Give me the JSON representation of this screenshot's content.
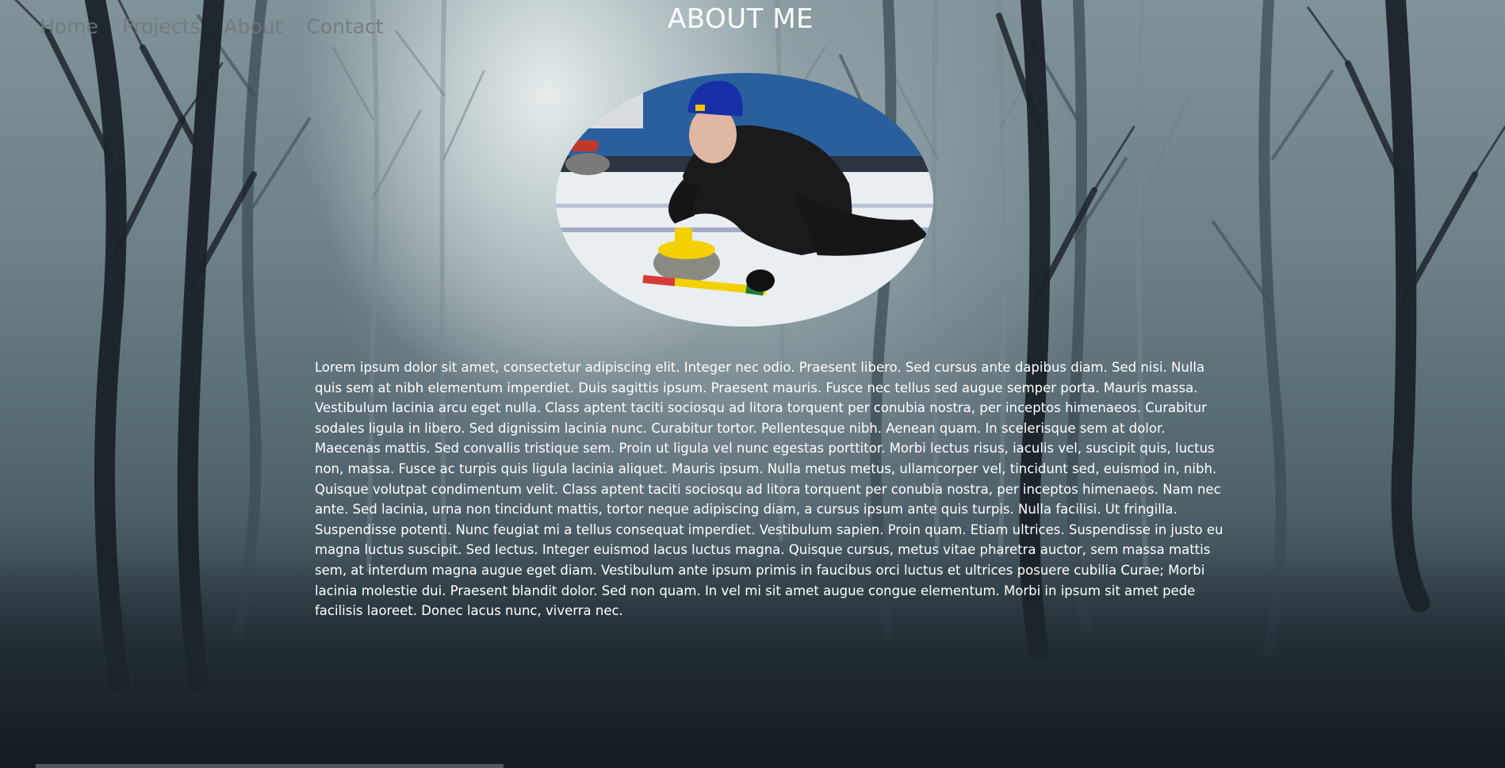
{
  "nav": {
    "items": [
      {
        "label": "Home"
      },
      {
        "label": "Projects"
      },
      {
        "label": "About"
      },
      {
        "label": "Contact"
      }
    ]
  },
  "page": {
    "title": "ABOUT ME"
  },
  "profile_photo": {
    "icon": "curling-player-photo"
  },
  "bio": {
    "text": "Lorem ipsum dolor sit amet, consectetur adipiscing elit. Integer nec odio. Praesent libero. Sed cursus ante dapibus diam. Sed nisi. Nulla quis sem at nibh elementum imperdiet. Duis sagittis ipsum. Praesent mauris. Fusce nec tellus sed augue semper porta. Mauris massa. Vestibulum lacinia arcu eget nulla. Class aptent taciti sociosqu ad litora torquent per conubia nostra, per inceptos himenaeos. Curabitur sodales ligula in libero. Sed dignissim lacinia nunc. Curabitur tortor. Pellentesque nibh. Aenean quam. In scelerisque sem at dolor. Maecenas mattis. Sed convallis tristique sem. Proin ut ligula vel nunc egestas porttitor. Morbi lectus risus, iaculis vel, suscipit quis, luctus non, massa. Fusce ac turpis quis ligula lacinia aliquet. Mauris ipsum. Nulla metus metus, ullamcorper vel, tincidunt sed, euismod in, nibh. Quisque volutpat condimentum velit. Class aptent taciti sociosqu ad litora torquent per conubia nostra, per inceptos himenaeos. Nam nec ante. Sed lacinia, urna non tincidunt mattis, tortor neque adipiscing diam, a cursus ipsum ante quis turpis. Nulla facilisi. Ut fringilla. Suspendisse potenti. Nunc feugiat mi a tellus consequat imperdiet. Vestibulum sapien. Proin quam. Etiam ultrices. Suspendisse in justo eu magna luctus suscipit. Sed lectus. Integer euismod lacus luctus magna. Quisque cursus, metus vitae pharetra auctor, sem massa mattis sem, at interdum magna augue eget diam. Vestibulum ante ipsum primis in faucibus orci luctus et ultrices posuere cubilia Curae; Morbi lacinia molestie dui. Praesent blandit dolor. Sed non quam. In vel mi sit amet augue congue elementum. Morbi in ipsum sit amet pede facilisis laoreet. Donec lacus nunc, viverra nec."
  },
  "colors": {
    "title": "#ffffff",
    "body_text": "#ffffff",
    "nav_text": "#6e787c",
    "background": "#4f626a"
  }
}
